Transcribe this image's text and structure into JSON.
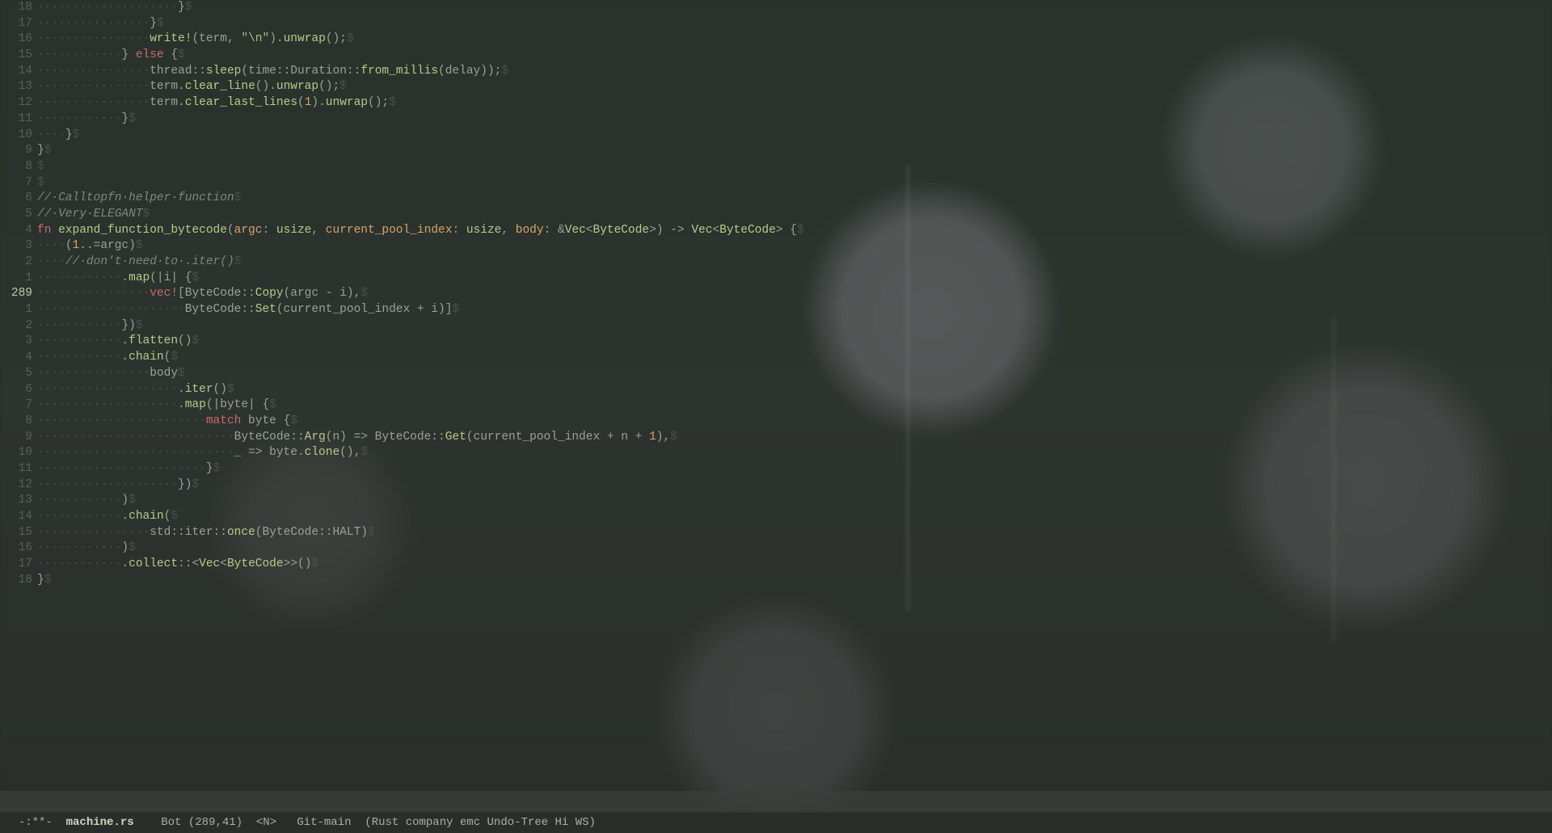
{
  "modeline": {
    "left": "-:**-  ",
    "filename": "machine.rs",
    "mid": "    Bot (289,41)  <N>   Git-main  (Rust company emc Undo-Tree Hi WS)"
  },
  "cursor_abs": 289,
  "lines": [
    {
      "rel": "18",
      "indent": 20,
      "tokens": [
        [
          "pu",
          "}"
        ]
      ]
    },
    {
      "rel": "17",
      "indent": 16,
      "tokens": [
        [
          "pu",
          "}"
        ]
      ]
    },
    {
      "rel": "16",
      "indent": 16,
      "tokens": [
        [
          "fn",
          "write!"
        ],
        [
          "pu",
          "(term, "
        ],
        [
          "st",
          "\"\\n\""
        ],
        [
          "pu",
          ")."
        ],
        [
          "fn",
          "unwrap"
        ],
        [
          "pu",
          "();"
        ]
      ]
    },
    {
      "rel": "15",
      "indent": 12,
      "tokens": [
        [
          "pu",
          "} "
        ],
        [
          "kw",
          "else"
        ],
        [
          "pu",
          " {"
        ]
      ]
    },
    {
      "rel": "14",
      "indent": 16,
      "tokens": [
        [
          "pu",
          "thread::"
        ],
        [
          "fn",
          "sleep"
        ],
        [
          "pu",
          "(time::Duration::"
        ],
        [
          "fn",
          "from_millis"
        ],
        [
          "pu",
          "(delay));"
        ]
      ]
    },
    {
      "rel": "13",
      "indent": 16,
      "tokens": [
        [
          "pu",
          "term."
        ],
        [
          "fn",
          "clear_line"
        ],
        [
          "pu",
          "()."
        ],
        [
          "fn",
          "unwrap"
        ],
        [
          "pu",
          "();"
        ]
      ]
    },
    {
      "rel": "12",
      "indent": 16,
      "tokens": [
        [
          "pu",
          "term."
        ],
        [
          "fn",
          "clear_last_lines"
        ],
        [
          "pu",
          "("
        ],
        [
          "nu",
          "1"
        ],
        [
          "pu",
          ")."
        ],
        [
          "fn",
          "unwrap"
        ],
        [
          "pu",
          "();"
        ]
      ]
    },
    {
      "rel": "11",
      "indent": 12,
      "tokens": [
        [
          "pu",
          "}"
        ]
      ]
    },
    {
      "rel": "10",
      "indent": 4,
      "tokens": [
        [
          "pu",
          "}"
        ]
      ]
    },
    {
      "rel": "9",
      "indent": 0,
      "tokens": [
        [
          "pu",
          "}"
        ]
      ]
    },
    {
      "rel": "8",
      "indent": 0,
      "tokens": []
    },
    {
      "rel": "7",
      "indent": 0,
      "tokens": []
    },
    {
      "rel": "6",
      "indent": 0,
      "tokens": [
        [
          "co",
          "// Calltopfn helper function"
        ]
      ]
    },
    {
      "rel": "5",
      "indent": 0,
      "tokens": [
        [
          "co",
          "// Very ELEGANT"
        ]
      ]
    },
    {
      "rel": "4",
      "indent": 0,
      "tokens": [
        [
          "kw",
          "fn "
        ],
        [
          "fn",
          "expand_function_bytecode"
        ],
        [
          "pu",
          "("
        ],
        [
          "pa",
          "argc"
        ],
        [
          "pu",
          ": "
        ],
        [
          "ty",
          "usize"
        ],
        [
          "pu",
          ", "
        ],
        [
          "pa",
          "current_pool_index"
        ],
        [
          "pu",
          ": "
        ],
        [
          "ty",
          "usize"
        ],
        [
          "pu",
          ", "
        ],
        [
          "pa",
          "body"
        ],
        [
          "pu",
          ": &"
        ],
        [
          "ty",
          "Vec"
        ],
        [
          "pu",
          "<"
        ],
        [
          "ty",
          "ByteCode"
        ],
        [
          "pu",
          ">) -> "
        ],
        [
          "ty",
          "Vec"
        ],
        [
          "pu",
          "<"
        ],
        [
          "ty",
          "ByteCode"
        ],
        [
          "pu",
          "> {"
        ]
      ]
    },
    {
      "rel": "3",
      "indent": 4,
      "tokens": [
        [
          "pu",
          "("
        ],
        [
          "nu",
          "1"
        ],
        [
          "pu",
          "..=argc)"
        ]
      ]
    },
    {
      "rel": "2",
      "indent": 4,
      "tokens": [
        [
          "co",
          "// don't need to .iter()"
        ]
      ]
    },
    {
      "rel": "1",
      "indent": 12,
      "tokens": [
        [
          "pu",
          "."
        ],
        [
          "fn",
          "map"
        ],
        [
          "pu",
          "(|i| {"
        ]
      ]
    },
    {
      "rel": "289",
      "indent": 16,
      "current": true,
      "tokens": [
        [
          "kw",
          "vec!"
        ],
        [
          "pu",
          "[ByteCode::"
        ],
        [
          "fn",
          "Copy"
        ],
        [
          "pu",
          "(argc - i),"
        ]
      ]
    },
    {
      "rel": "1",
      "indent": 21,
      "tokens": [
        [
          "pu",
          "ByteCode::"
        ],
        [
          "fn",
          "Set"
        ],
        [
          "pu",
          "(current_pool_index + i)]"
        ]
      ]
    },
    {
      "rel": "2",
      "indent": 12,
      "tokens": [
        [
          "pu",
          "})"
        ]
      ]
    },
    {
      "rel": "3",
      "indent": 12,
      "tokens": [
        [
          "pu",
          "."
        ],
        [
          "fn",
          "flatten"
        ],
        [
          "pu",
          "()"
        ]
      ]
    },
    {
      "rel": "4",
      "indent": 12,
      "tokens": [
        [
          "pu",
          "."
        ],
        [
          "fn",
          "chain"
        ],
        [
          "pu",
          "("
        ]
      ]
    },
    {
      "rel": "5",
      "indent": 16,
      "tokens": [
        [
          "pu",
          "body"
        ]
      ]
    },
    {
      "rel": "6",
      "indent": 20,
      "tokens": [
        [
          "pu",
          "."
        ],
        [
          "fn",
          "iter"
        ],
        [
          "pu",
          "()"
        ]
      ]
    },
    {
      "rel": "7",
      "indent": 20,
      "tokens": [
        [
          "pu",
          "."
        ],
        [
          "fn",
          "map"
        ],
        [
          "pu",
          "(|byte| {"
        ]
      ]
    },
    {
      "rel": "8",
      "indent": 24,
      "tokens": [
        [
          "kw",
          "match"
        ],
        [
          "pu",
          " byte {"
        ]
      ]
    },
    {
      "rel": "9",
      "indent": 28,
      "tokens": [
        [
          "pu",
          "ByteCode::"
        ],
        [
          "fn",
          "Arg"
        ],
        [
          "pu",
          "(n) => ByteCode::"
        ],
        [
          "fn",
          "Get"
        ],
        [
          "pu",
          "(current_pool_index + n + "
        ],
        [
          "nu",
          "1"
        ],
        [
          "pu",
          "),"
        ]
      ]
    },
    {
      "rel": "10",
      "indent": 28,
      "tokens": [
        [
          "pu",
          "_ => byte."
        ],
        [
          "fn",
          "clone"
        ],
        [
          "pu",
          "(),"
        ]
      ]
    },
    {
      "rel": "11",
      "indent": 24,
      "tokens": [
        [
          "pu",
          "}"
        ]
      ]
    },
    {
      "rel": "12",
      "indent": 20,
      "tokens": [
        [
          "pu",
          "})"
        ]
      ]
    },
    {
      "rel": "13",
      "indent": 12,
      "tokens": [
        [
          "pu",
          ")"
        ]
      ]
    },
    {
      "rel": "14",
      "indent": 12,
      "tokens": [
        [
          "pu",
          "."
        ],
        [
          "fn",
          "chain"
        ],
        [
          "pu",
          "("
        ]
      ]
    },
    {
      "rel": "15",
      "indent": 16,
      "tokens": [
        [
          "pu",
          "std::iter::"
        ],
        [
          "fn",
          "once"
        ],
        [
          "pu",
          "(ByteCode::HALT)"
        ]
      ]
    },
    {
      "rel": "16",
      "indent": 12,
      "tokens": [
        [
          "pu",
          ")"
        ]
      ]
    },
    {
      "rel": "17",
      "indent": 12,
      "tokens": [
        [
          "pu",
          "."
        ],
        [
          "fn",
          "collect"
        ],
        [
          "pu",
          "::<"
        ],
        [
          "ty",
          "Vec"
        ],
        [
          "pu",
          "<"
        ],
        [
          "ty",
          "ByteCode"
        ],
        [
          "pu",
          ">>()"
        ]
      ]
    },
    {
      "rel": "18",
      "indent": 0,
      "tokens": [
        [
          "pu",
          "}"
        ]
      ]
    }
  ]
}
